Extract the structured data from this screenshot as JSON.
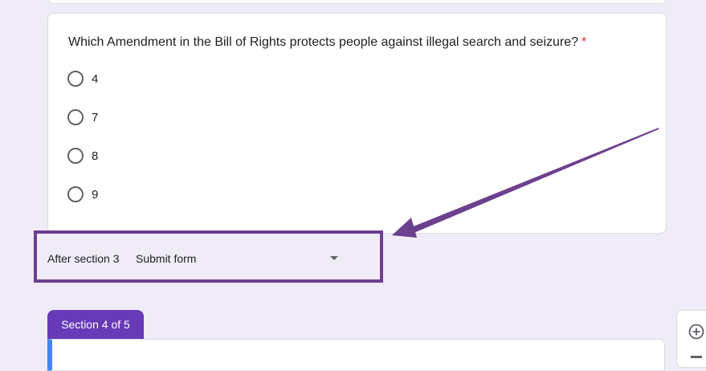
{
  "question": {
    "text": "Which Amendment in the Bill of Rights protects people against illegal search and seizure?",
    "required_marker": "*",
    "options": [
      "4",
      "7",
      "8",
      "9"
    ]
  },
  "after_section": {
    "label": "After section 3",
    "selected": "Submit form"
  },
  "section_tab": {
    "label": "Section 4 of 5"
  },
  "colors": {
    "page_bg": "#efebf7",
    "accent": "#673ab7",
    "annotation": "#6d3f8f",
    "required": "#d93025",
    "section_bar": "#4285f4"
  },
  "icons": [
    "chevron-down-icon",
    "add-question-icon",
    "annotation-arrow"
  ]
}
